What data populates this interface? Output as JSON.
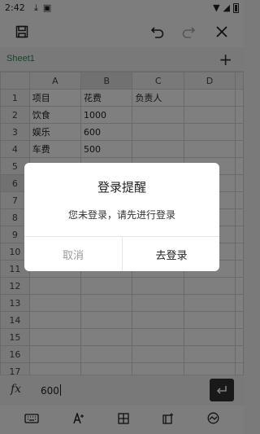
{
  "statusbar": {
    "time": "2:42"
  },
  "sheet": {
    "tab_label": "Sheet1",
    "add_label": "+"
  },
  "grid": {
    "columns": [
      "A",
      "B",
      "C",
      "D"
    ],
    "rows": [
      {
        "n": "1",
        "a": "项目",
        "b": "花费",
        "c": "负责人",
        "d": ""
      },
      {
        "n": "2",
        "a": "饮食",
        "b": "1000",
        "c": "",
        "d": ""
      },
      {
        "n": "3",
        "a": "娱乐",
        "b": "600",
        "c": "",
        "d": ""
      },
      {
        "n": "4",
        "a": "车费",
        "b": "500",
        "c": "",
        "d": ""
      },
      {
        "n": "5",
        "a": "",
        "b": "",
        "c": "",
        "d": ""
      },
      {
        "n": "6",
        "a": "",
        "b": "",
        "c": "",
        "d": ""
      },
      {
        "n": "7",
        "a": "",
        "b": "",
        "c": "",
        "d": ""
      },
      {
        "n": "8",
        "a": "",
        "b": "",
        "c": "",
        "d": ""
      },
      {
        "n": "9",
        "a": "",
        "b": "",
        "c": "",
        "d": ""
      },
      {
        "n": "10",
        "a": "",
        "b": "",
        "c": "",
        "d": ""
      },
      {
        "n": "11",
        "a": "",
        "b": "",
        "c": "",
        "d": ""
      },
      {
        "n": "12",
        "a": "",
        "b": "",
        "c": "",
        "d": ""
      },
      {
        "n": "13",
        "a": "",
        "b": "",
        "c": "",
        "d": ""
      },
      {
        "n": "14",
        "a": "",
        "b": "",
        "c": "",
        "d": ""
      },
      {
        "n": "15",
        "a": "",
        "b": "",
        "c": "",
        "d": ""
      },
      {
        "n": "16",
        "a": "",
        "b": "",
        "c": "",
        "d": ""
      },
      {
        "n": "17",
        "a": "",
        "b": "",
        "c": "",
        "d": ""
      }
    ]
  },
  "formula": {
    "fx_label": "fx",
    "value": "600"
  },
  "dialog": {
    "title": "登录提醒",
    "message": "您未登录，请先进行登录",
    "cancel_label": "取消",
    "confirm_label": "去登录"
  }
}
